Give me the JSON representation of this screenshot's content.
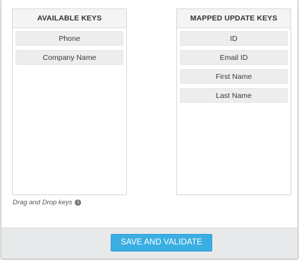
{
  "available": {
    "title": "AVAILABLE KEYS",
    "items": [
      "Phone",
      "Company Name"
    ]
  },
  "mapped": {
    "title": "MAPPED UPDATE KEYS",
    "items": [
      "ID",
      "Email ID",
      "First Name",
      "Last Name"
    ]
  },
  "hint": {
    "text": "Drag and Drop keys",
    "icon": "info-icon"
  },
  "footer": {
    "save_label": "SAVE AND VALIDATE"
  },
  "colors": {
    "accent": "#3aaee2",
    "footer_bg": "#e8e9eb",
    "item_bg": "#ededed"
  }
}
